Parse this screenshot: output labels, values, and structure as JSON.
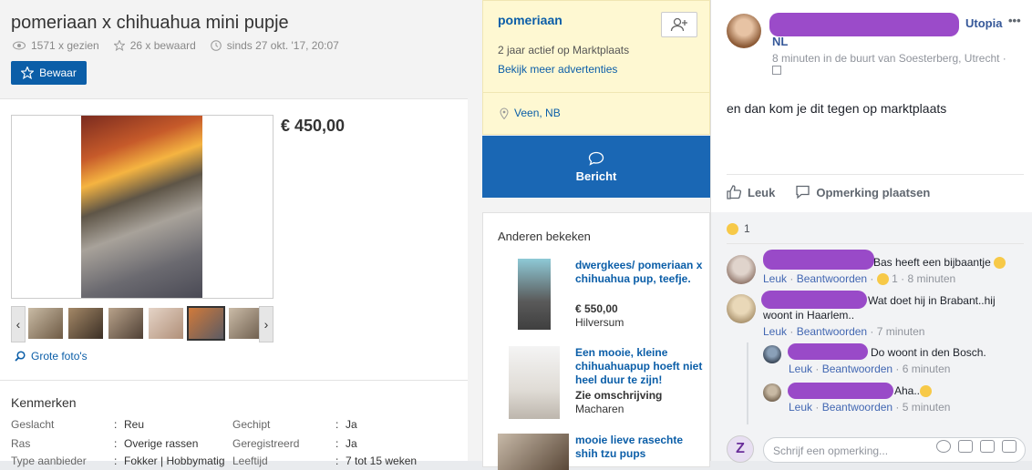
{
  "listing": {
    "title": "pomeriaan x chihuahua mini pupje",
    "views": "1571 x gezien",
    "saved": "26 x bewaard",
    "since": "sinds 27 okt. '17, 20:07",
    "save_label": "Bewaar",
    "price": "€ 450,00",
    "large_photos": "Grote foto's",
    "thumb_prev": "‹",
    "thumb_next": "›"
  },
  "kenmerken": {
    "title": "Kenmerken",
    "rows": [
      {
        "l1": "Geslacht",
        "v1": "Reu",
        "l2": "Gechipt",
        "v2": "Ja"
      },
      {
        "l1": "Ras",
        "v1": "Overige rassen",
        "l2": "Geregistreerd",
        "v2": "Ja"
      },
      {
        "l1": "Type aanbieder",
        "v1": "Fokker | Hobbymatig",
        "l2": "Leeftijd",
        "v2": "7 tot 15 weken"
      }
    ]
  },
  "seller": {
    "name": "pomeriaan",
    "active": "2 jaar actief op Marktplaats",
    "more_ads": "Bekijk meer advertenties",
    "location": "Veen, NB",
    "message_label": "Bericht"
  },
  "others": {
    "title": "Anderen bekeken",
    "ads": [
      {
        "title": "dwergkees/ pomeriaan x chihuahua pup, teefje.",
        "price": "€ 550,00",
        "location": "Hilversum"
      },
      {
        "title": "Een mooie, kleine chihuahuapup hoeft niet heel duur te zijn!",
        "price": "Zie omschrijving",
        "location": "Macharen"
      },
      {
        "title": "mooie lieve rasechte shih tzu pups",
        "price": "",
        "location": ""
      }
    ]
  },
  "facebook": {
    "group": "Utopia",
    "group_suffix": "NL",
    "more": "•••",
    "meta": "8 minuten in de buurt van Soesterberg, Utrecht ·",
    "post": "en dan kom je dit tegen op marktplaats",
    "like": "Leuk",
    "comment_action": "Opmerking plaatsen",
    "reaction_count": "1",
    "comments": [
      {
        "text": "Bas heeft een bijbaantje",
        "like": "Leuk",
        "reply": "Beantwoorden",
        "reactions": "1",
        "time": "8 minuten"
      },
      {
        "text": "Wat doet hij in Brabant..hij woont in Haarlem..",
        "like": "Leuk",
        "reply": "Beantwoorden",
        "time": "7 minuten"
      },
      {
        "text": "Do woont in den Bosch.",
        "like": "Leuk",
        "reply": "Beantwoorden",
        "time": "6 minuten"
      },
      {
        "text": "Aha..",
        "like": "Leuk",
        "reply": "Beantwoorden",
        "time": "5 minuten"
      }
    ],
    "compose_placeholder": "Schrijf een opmerking..."
  },
  "colors": {
    "marktplaats_blue": "#0b5ea8",
    "seller_bg": "#fef8d2",
    "redaction": "#8a2bbf",
    "fb_link": "#4267b2"
  }
}
